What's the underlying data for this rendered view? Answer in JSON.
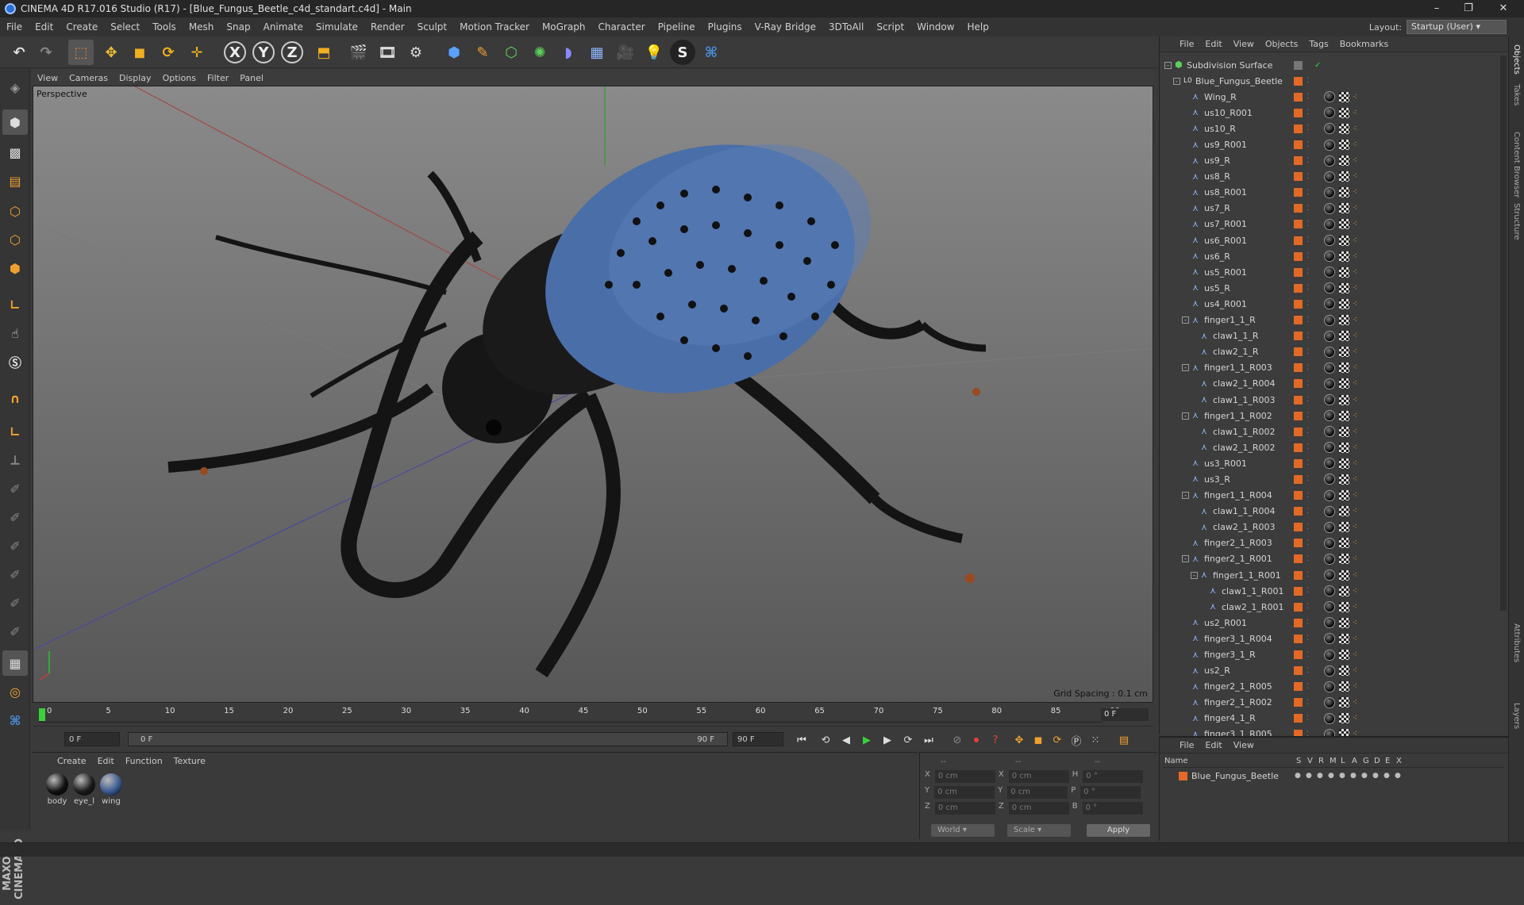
{
  "window": {
    "title": "CINEMA 4D R17.016 Studio (R17) - [Blue_Fungus_Beetle_c4d_standart.c4d] - Main"
  },
  "menu": [
    "File",
    "Edit",
    "Create",
    "Select",
    "Tools",
    "Mesh",
    "Snap",
    "Animate",
    "Simulate",
    "Render",
    "Sculpt",
    "Motion Tracker",
    "MoGraph",
    "Character",
    "Pipeline",
    "Plugins",
    "V-Ray Bridge",
    "3DToAll",
    "Script",
    "Window",
    "Help"
  ],
  "layout": {
    "label": "Layout:",
    "value": "Startup (User)"
  },
  "viewport": {
    "menu": [
      "View",
      "Cameras",
      "Display",
      "Options",
      "Filter",
      "Panel"
    ],
    "label": "Perspective",
    "grid_spacing": "Grid Spacing : 0.1 cm"
  },
  "timeline": {
    "ticks": [
      "0",
      "5",
      "10",
      "15",
      "20",
      "25",
      "30",
      "35",
      "40",
      "45",
      "50",
      "55",
      "60",
      "65",
      "70",
      "75",
      "80",
      "85",
      "90"
    ],
    "current_frame": "0 F",
    "start_field": "0 F",
    "range_start": "0 F",
    "range_end": "90 F",
    "end_field": "90 F"
  },
  "materials": {
    "menu": [
      "Create",
      "Edit",
      "Function",
      "Texture"
    ],
    "items": [
      {
        "name": "body",
        "color": "#111111"
      },
      {
        "name": "eye_l",
        "color": "#1a1a1a"
      },
      {
        "name": "wing",
        "color": "#3a5a90"
      }
    ]
  },
  "coords": {
    "header1": "--",
    "header2": "--",
    "header3": "--",
    "rows": [
      {
        "a": "X",
        "av": "0 cm",
        "b": "X",
        "bv": "0 cm",
        "c": "H",
        "cv": "0 °"
      },
      {
        "a": "Y",
        "av": "0 cm",
        "b": "Y",
        "bv": "0 cm",
        "c": "P",
        "cv": "0 °"
      },
      {
        "a": "Z",
        "av": "0 cm",
        "b": "Z",
        "bv": "0 cm",
        "c": "B",
        "cv": "0 °"
      }
    ],
    "mode": "World",
    "scale": "Scale",
    "apply": "Apply"
  },
  "objects": {
    "menu": [
      "File",
      "Edit",
      "View",
      "Objects",
      "Tags",
      "Bookmarks"
    ],
    "tree": [
      {
        "name": "Subdivision Surface",
        "depth": 0,
        "expand": "-",
        "icon": "subdiv",
        "special": "root"
      },
      {
        "name": "Blue_Fungus_Beetle",
        "depth": 1,
        "expand": "-",
        "icon": "null"
      },
      {
        "name": "Wing_R",
        "depth": 2
      },
      {
        "name": "us10_R001",
        "depth": 2
      },
      {
        "name": "us10_R",
        "depth": 2
      },
      {
        "name": "us9_R001",
        "depth": 2
      },
      {
        "name": "us9_R",
        "depth": 2
      },
      {
        "name": "us8_R",
        "depth": 2
      },
      {
        "name": "us8_R001",
        "depth": 2
      },
      {
        "name": "us7_R",
        "depth": 2
      },
      {
        "name": "us7_R001",
        "depth": 2
      },
      {
        "name": "us6_R001",
        "depth": 2
      },
      {
        "name": "us6_R",
        "depth": 2
      },
      {
        "name": "us5_R001",
        "depth": 2
      },
      {
        "name": "us5_R",
        "depth": 2
      },
      {
        "name": "us4_R001",
        "depth": 2
      },
      {
        "name": "finger1_1_R",
        "depth": 2,
        "expand": "-"
      },
      {
        "name": "claw1_1_R",
        "depth": 3
      },
      {
        "name": "claw2_1_R",
        "depth": 3
      },
      {
        "name": "finger1_1_R003",
        "depth": 2,
        "expand": "-"
      },
      {
        "name": "claw2_1_R004",
        "depth": 3
      },
      {
        "name": "claw1_1_R003",
        "depth": 3
      },
      {
        "name": "finger1_1_R002",
        "depth": 2,
        "expand": "-"
      },
      {
        "name": "claw1_1_R002",
        "depth": 3
      },
      {
        "name": "claw2_1_R002",
        "depth": 3
      },
      {
        "name": "us3_R001",
        "depth": 2
      },
      {
        "name": "us3_R",
        "depth": 2
      },
      {
        "name": "finger1_1_R004",
        "depth": 2,
        "expand": "-"
      },
      {
        "name": "claw1_1_R004",
        "depth": 3
      },
      {
        "name": "claw2_1_R003",
        "depth": 3
      },
      {
        "name": "finger2_1_R003",
        "depth": 2
      },
      {
        "name": "finger2_1_R001",
        "depth": 2,
        "expand": "-"
      },
      {
        "name": "finger1_1_R001",
        "depth": 3,
        "expand": "-"
      },
      {
        "name": "claw1_1_R001",
        "depth": 4
      },
      {
        "name": "claw2_1_R001",
        "depth": 4
      },
      {
        "name": "us2_R001",
        "depth": 2
      },
      {
        "name": "finger3_1_R004",
        "depth": 2
      },
      {
        "name": "finger3_1_R",
        "depth": 2
      },
      {
        "name": "us2_R",
        "depth": 2
      },
      {
        "name": "finger2_1_R005",
        "depth": 2
      },
      {
        "name": "finger2_1_R002",
        "depth": 2
      },
      {
        "name": "finger4_1_R",
        "depth": 2
      },
      {
        "name": "finger3_1_R005",
        "depth": 2
      }
    ]
  },
  "layers": {
    "menu": [
      "File",
      "Edit",
      "View"
    ],
    "columns": [
      "Name",
      "S",
      "V",
      "R",
      "M",
      "L",
      "A",
      "G",
      "D",
      "E",
      "X"
    ],
    "items": [
      {
        "name": "Blue_Fungus_Beetle",
        "color": "#e26a26"
      }
    ]
  },
  "side_tabs": [
    "Objects",
    "Takes",
    "Content Browser",
    "Structure",
    "Attributes",
    "Layers"
  ],
  "colors": {
    "accent": "#e26a26",
    "selection": "#2a6fd6",
    "viewport_bg": "#707070",
    "beetle_shell": "#4a6ea8"
  }
}
